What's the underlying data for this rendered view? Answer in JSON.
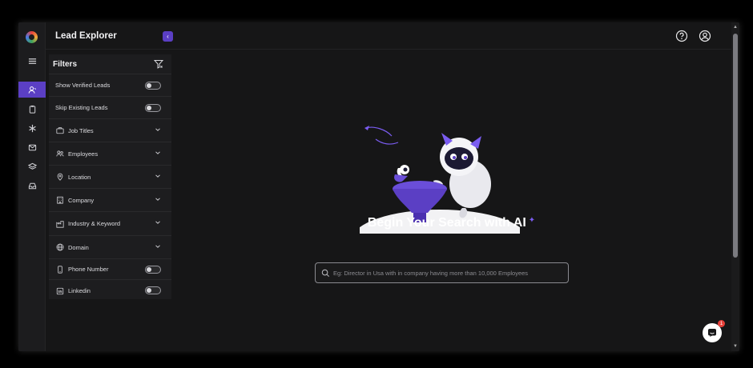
{
  "app": {
    "title": "Lead Explorer"
  },
  "filters": {
    "heading": "Filters",
    "items": [
      {
        "label": "Show Verified Leads",
        "kind": "toggle",
        "icon": ""
      },
      {
        "label": "Skip Existing Leads",
        "kind": "toggle",
        "icon": ""
      },
      {
        "label": "Job Titles",
        "kind": "dropdown",
        "icon": "briefcase-icon"
      },
      {
        "label": "Employees",
        "kind": "dropdown",
        "icon": "users-icon"
      },
      {
        "label": "Location",
        "kind": "dropdown",
        "icon": "map-pin-icon"
      },
      {
        "label": "Company",
        "kind": "dropdown",
        "icon": "building-icon"
      },
      {
        "label": "Industry & Keyword",
        "kind": "dropdown",
        "icon": "factory-icon"
      },
      {
        "label": "Domain",
        "kind": "dropdown",
        "icon": "globe-icon"
      },
      {
        "label": "Phone Number",
        "kind": "toggle",
        "icon": "phone-icon"
      },
      {
        "label": "Linkedin",
        "kind": "toggle",
        "icon": "linkedin-icon"
      }
    ]
  },
  "main": {
    "heading": "Begin Your Search with AI",
    "search_placeholder": "Eg: Director in Usa with in company having more than 10,000 Employees"
  },
  "chat": {
    "badge": "1"
  },
  "colors": {
    "accent": "#5b3fc4",
    "background": "#161617",
    "panel": "#1d1d1f"
  }
}
